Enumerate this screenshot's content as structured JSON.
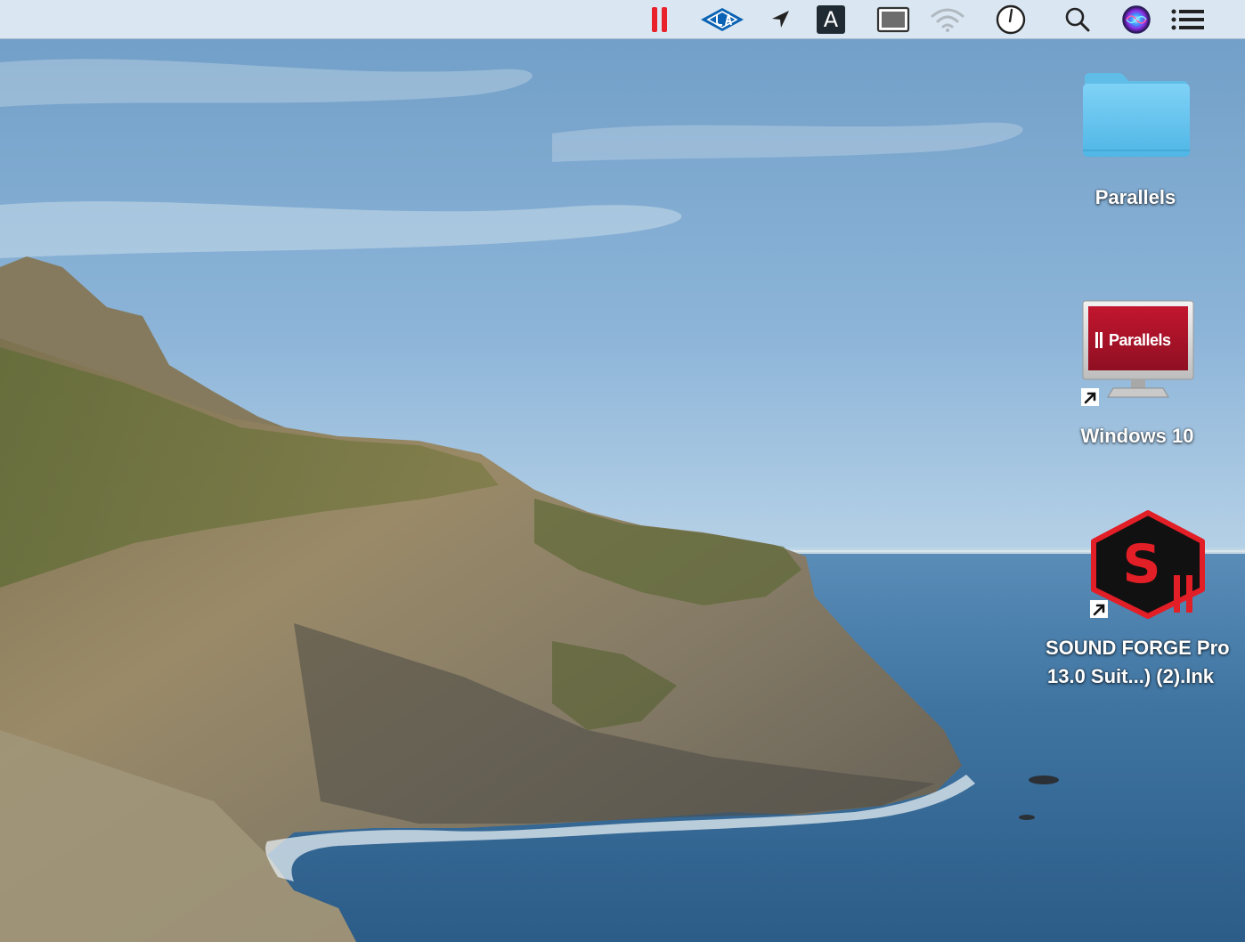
{
  "menubar": {
    "background": "#e2ecf4",
    "items": [
      {
        "name": "parallels-pause-icon",
        "color": "#e8212a"
      },
      {
        "name": "universal-audio-icon",
        "color": "#0a63b4"
      },
      {
        "name": "location-arrow-icon",
        "color": "#222222"
      },
      {
        "name": "input-source-icon",
        "label": "A",
        "color": "#1f2a33"
      },
      {
        "name": "screen-display-icon",
        "color": "#333333"
      },
      {
        "name": "wifi-icon",
        "color": "#b0b8c0"
      },
      {
        "name": "clock-icon",
        "color": "#222222"
      },
      {
        "name": "spotlight-search-icon",
        "color": "#222222"
      },
      {
        "name": "siri-icon",
        "color": "#2a1f5c"
      },
      {
        "name": "notification-center-icon",
        "color": "#222222"
      }
    ]
  },
  "desktop": {
    "icons": [
      {
        "name": "folder-icon",
        "label": "Parallels",
        "color": "#5fc4f2"
      },
      {
        "name": "parallels-vm-icon",
        "label": "Windows 10",
        "screen_text": "Parallels",
        "color": "#b3122a"
      },
      {
        "name": "sound-forge-icon",
        "label_line1": "SOUND FORGE Pro",
        "label_line2": "13.0 Suit...) (2).lnk",
        "badge": "S",
        "color": "#e21e26"
      }
    ]
  }
}
